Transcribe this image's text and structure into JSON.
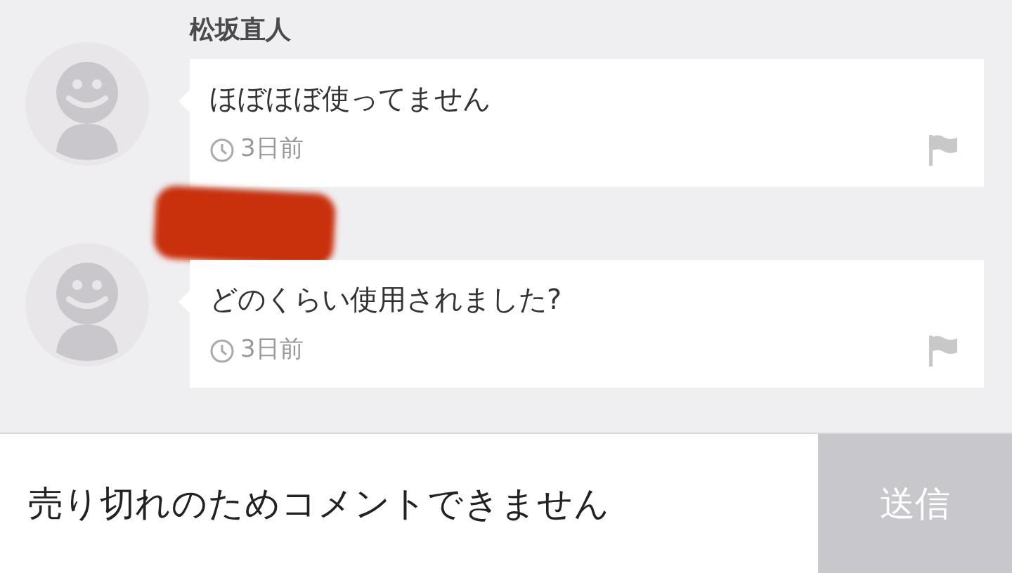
{
  "comments": [
    {
      "author": "松坂直人",
      "redacted": false,
      "text": "ほぼほぼ使ってません",
      "time": "3日前"
    },
    {
      "redacted": true,
      "text": "どのくらい使用されました?",
      "time": "3日前"
    }
  ],
  "footer": {
    "notice": "売り切れのためコメントできません",
    "send_button": {
      "label": "送信",
      "disabled": true
    }
  }
}
